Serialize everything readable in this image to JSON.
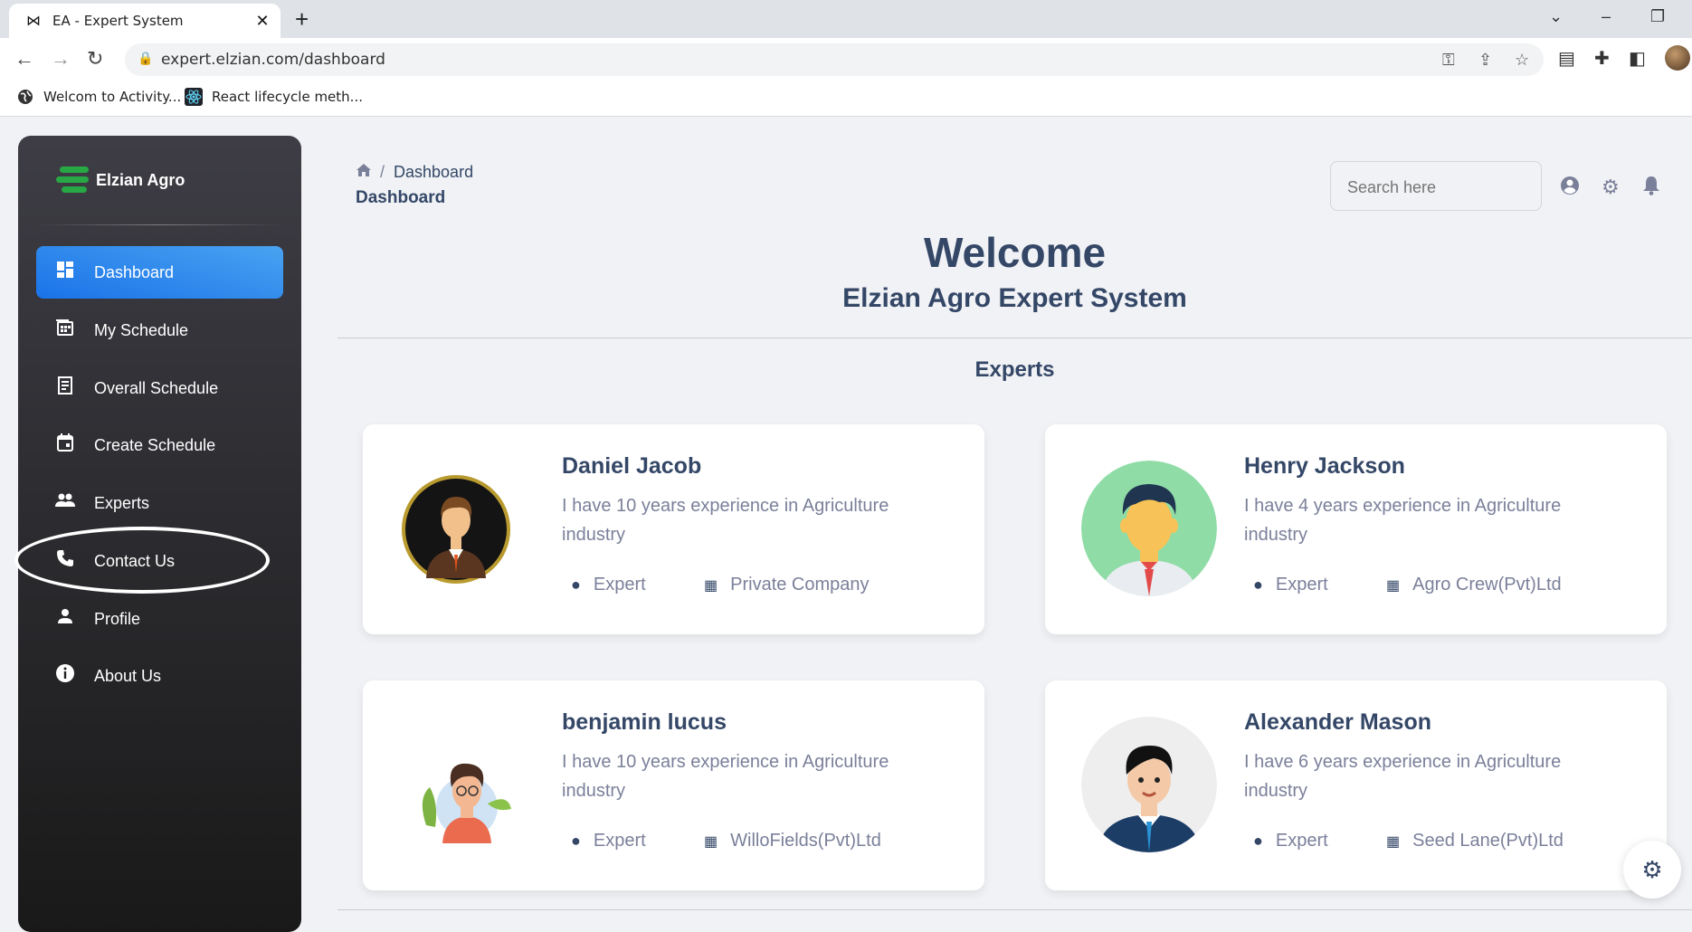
{
  "browser": {
    "tab_title": "EA - Expert System",
    "url": "expert.elzian.com/dashboard",
    "bookmarks": [
      {
        "label": "Welcom to Activity...",
        "icon": "globe-icon"
      },
      {
        "label": "React lifecycle meth...",
        "icon": "react-icon"
      }
    ]
  },
  "sidebar": {
    "brand": "Elzian Agro",
    "items": [
      {
        "label": "Dashboard",
        "icon": "dashboard-icon",
        "active": true
      },
      {
        "label": "My Schedule",
        "icon": "schedule-icon"
      },
      {
        "label": "Overall Schedule",
        "icon": "receipt-icon"
      },
      {
        "label": "Create Schedule",
        "icon": "calendar-icon"
      },
      {
        "label": "Experts",
        "icon": "people-icon"
      },
      {
        "label": "Contact Us",
        "icon": "phone-icon"
      },
      {
        "label": "Profile",
        "icon": "person-icon"
      },
      {
        "label": "About Us",
        "icon": "info-icon"
      }
    ]
  },
  "header": {
    "breadcrumb": "Dashboard",
    "title": "Dashboard",
    "search_placeholder": "Search here"
  },
  "main": {
    "welcome": "Welcome",
    "subtitle": "Elzian Agro Expert System",
    "section_title": "Experts",
    "experts": [
      {
        "name": "Daniel Jacob",
        "desc": "I have 10 years experience in Agriculture industry",
        "role": "Expert",
        "company": "Private Company"
      },
      {
        "name": "Henry Jackson",
        "desc": "I have 4 years experience in Agriculture industry",
        "role": "Expert",
        "company": "Agro Crew(Pvt)Ltd"
      },
      {
        "name": "benjamin lucus",
        "desc": "I have 10 years experience in Agriculture industry",
        "role": "Expert",
        "company": "WilloFields(Pvt)Ltd"
      },
      {
        "name": "Alexander Mason",
        "desc": "I have 6 years experience in Agriculture industry",
        "role": "Expert",
        "company": "Seed Lane(Pvt)Ltd"
      }
    ]
  },
  "colors": {
    "accent": "#1a73e8",
    "brand_green": "#28a745",
    "text_dark": "#344767",
    "text_muted": "#7b809a"
  }
}
